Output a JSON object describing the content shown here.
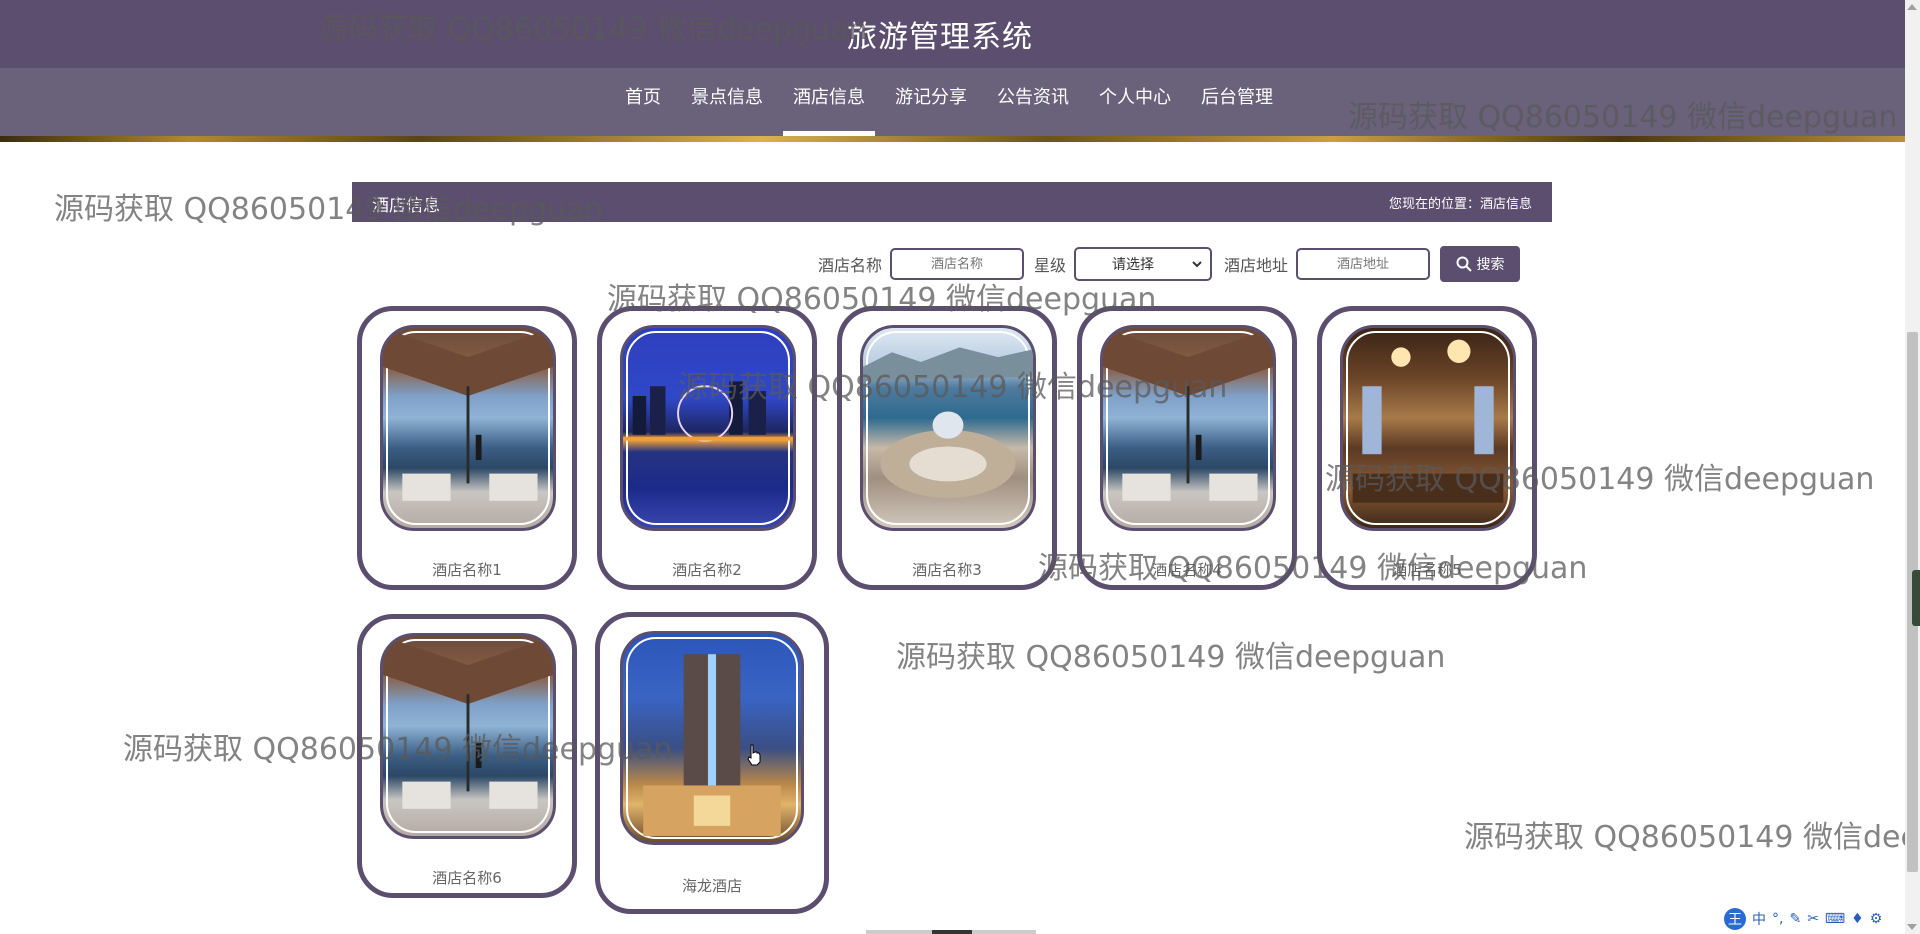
{
  "site": {
    "title": "旅游管理系统"
  },
  "nav": {
    "items": [
      {
        "label": "首页",
        "active": false
      },
      {
        "label": "景点信息",
        "active": false
      },
      {
        "label": "酒店信息",
        "active": true
      },
      {
        "label": "游记分享",
        "active": false
      },
      {
        "label": "公告资讯",
        "active": false
      },
      {
        "label": "个人中心",
        "active": false
      },
      {
        "label": "后台管理",
        "active": false
      }
    ]
  },
  "section": {
    "title": "酒店信息",
    "breadcrumb": "您现在的位置：酒店信息"
  },
  "search": {
    "name_label": "酒店名称",
    "name_placeholder": "酒店名称",
    "star_label": "星级",
    "star_selected": "请选择",
    "address_label": "酒店地址",
    "address_placeholder": "酒店地址",
    "button_label": "搜索"
  },
  "hotels": [
    {
      "name": "酒店名称1",
      "image": "villa"
    },
    {
      "name": "酒店名称2",
      "image": "city-night"
    },
    {
      "name": "酒店名称3",
      "image": "aerial-resort"
    },
    {
      "name": "酒店名称4",
      "image": "villa"
    },
    {
      "name": "酒店名称5",
      "image": "lobby"
    },
    {
      "name": "酒店名称6",
      "image": "villa"
    },
    {
      "name": "海龙酒店",
      "image": "tower"
    }
  ],
  "watermark_text": "源码获取 QQ86050149 微信deepguan",
  "ime": {
    "mode": "中"
  },
  "colors": {
    "primary": "#5b4e6e",
    "nav": "#6a617b"
  }
}
